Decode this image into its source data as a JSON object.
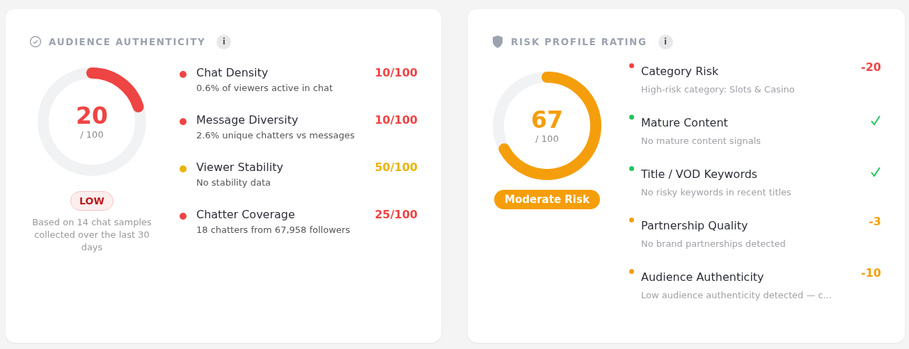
{
  "authenticity": {
    "title": "AUDIENCE AUTHENTICITY",
    "info": "i",
    "score": "20",
    "scale": "/ 100",
    "level": 0.2,
    "badge": "LOW",
    "note": "Based on 14 chat samples collected over the last 30 days",
    "metrics": [
      {
        "name": "Chat Density",
        "detail": "0.6% of viewers active in chat",
        "value": "10/100",
        "color": "#ef4444"
      },
      {
        "name": "Message Diversity",
        "detail": "2.6% unique chatters vs messages",
        "value": "10/100",
        "color": "#ef4444"
      },
      {
        "name": "Viewer Stability",
        "detail": "No stability data",
        "value": "50/100",
        "color": "#eab308"
      },
      {
        "name": "Chatter Coverage",
        "detail": "18 chatters from 67,958 followers",
        "value": "25/100",
        "color": "#ef4444"
      }
    ]
  },
  "risk": {
    "title": "RISK PROFILE RATING",
    "info": "i",
    "score": "67",
    "scale": "/ 100",
    "level": 0.67,
    "badge": "Moderate Risk",
    "factors": [
      {
        "kind": "score",
        "name": "Category Risk",
        "detail": "High-risk category: Slots & Casino",
        "value": "-20",
        "color": "#ef4444"
      },
      {
        "kind": "check",
        "name": "Mature Content",
        "detail": "No mature content signals",
        "color": "#22c55e"
      },
      {
        "kind": "check",
        "name": "Title / VOD Keywords",
        "detail": "No risky keywords in recent titles",
        "color": "#22c55e"
      },
      {
        "kind": "score",
        "name": "Partnership Quality",
        "detail": "No brand partnerships detected",
        "value": "-3",
        "color": "#f59e0b"
      },
      {
        "kind": "score",
        "name": "Audience Authenticity",
        "detail": "Low audience authenticity detected — c...",
        "value": "-10",
        "color": "#f59e0b"
      }
    ]
  }
}
